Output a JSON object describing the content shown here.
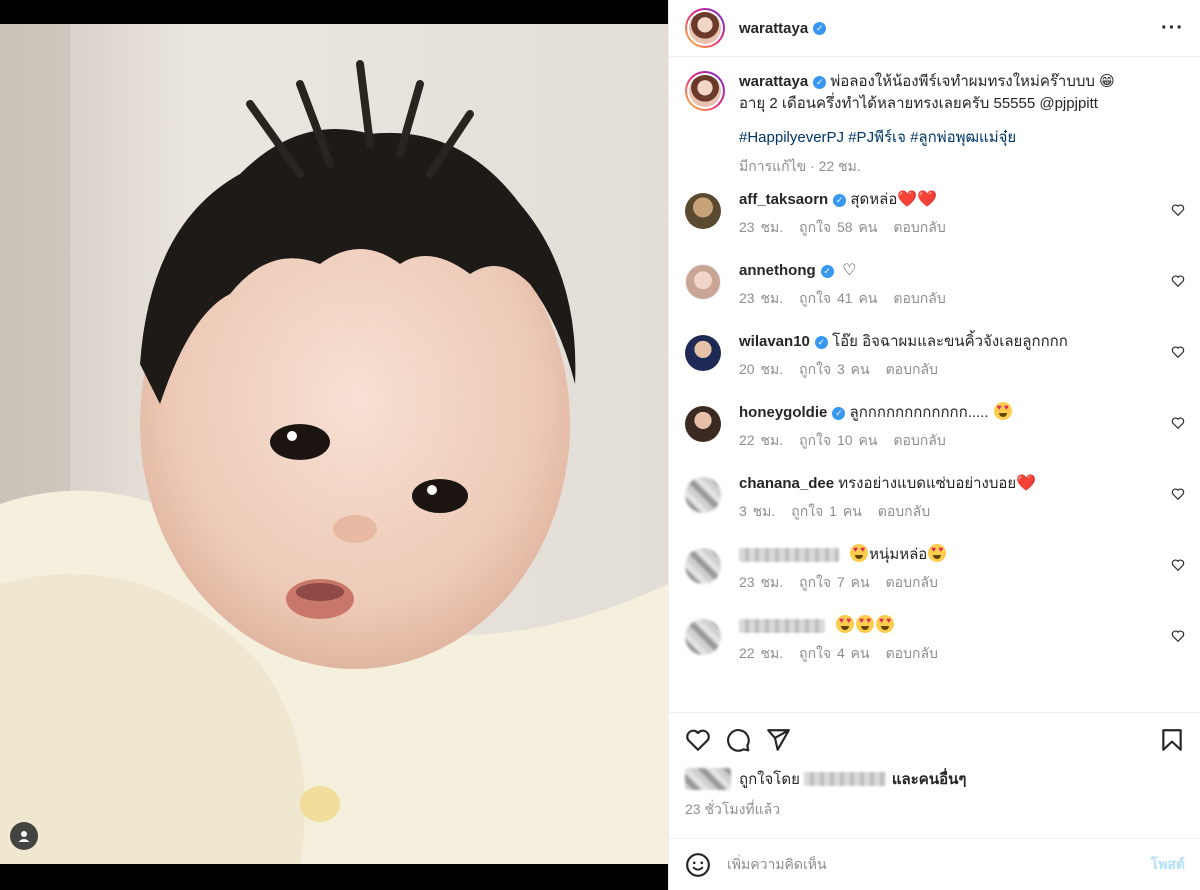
{
  "post": {
    "username": "warattaya",
    "caption_line1": "พ่อลองให้น้องพีร์เจทำผมทรงใหม่คร๊าบบบ 😁",
    "caption_line2": "อายุ 2 เดือนครึ่งทำได้หลายทรงเลยครับ 55555 @pjpjpitt",
    "hashtags": "#HappilyeverPJ #PJพีร์เจ #ลูกพ่อพุฒแม่จุ๋ย",
    "edited_meta": "มีการแก้ไข · 22 ชม."
  },
  "comments": [
    {
      "username": "aff_taksaorn",
      "verified": true,
      "text": "สุดหล่อ",
      "time": "23 ชม.",
      "likes": "ถูกใจ 58 คน",
      "reply": "ตอบกลับ",
      "avatar_color": "#7a6a4c"
    },
    {
      "username": "annethong",
      "verified": true,
      "text": "",
      "time": "23 ชม.",
      "likes": "ถูกใจ 41 คน",
      "reply": "ตอบกลับ",
      "avatar_color": "#d9c6bb"
    },
    {
      "username": "wilavan10",
      "verified": true,
      "text": "โอ๊ย อิจฉาผมและขนคิ้วจังเลยลูกกกก",
      "time": "20 ชม.",
      "likes": "ถูกใจ 3 คน",
      "reply": "ตอบกลับ",
      "avatar_color": "#2b3a6b"
    },
    {
      "username": "honeygoldie",
      "verified": true,
      "text": "ลูกกกกกกกกกกกก.....",
      "time": "22 ชม.",
      "likes": "ถูกใจ 10 คน",
      "reply": "ตอบกลับ",
      "avatar_color": "#4a3a32"
    },
    {
      "username": "chanana_dee",
      "verified": false,
      "text": "ทรงอย่างแบดแซ่บอย่างบอย",
      "time": "3 ชม.",
      "likes": "ถูกใจ 1 คน",
      "reply": "ตอบกลับ",
      "avatar_color": "#c9a28e"
    },
    {
      "username": "",
      "verified": false,
      "text": "หนุ่มหล่อ",
      "time": "23 ชม.",
      "likes": "ถูกใจ 7 คน",
      "reply": "ตอบกลับ",
      "avatar_color": "#999"
    },
    {
      "username": "",
      "verified": false,
      "text": "",
      "time": "22 ชม.",
      "likes": "ถูกใจ 4 คน",
      "reply": "ตอบกลับ",
      "avatar_color": "#999"
    }
  ],
  "footer": {
    "liked_by_prefix": "ถูกใจโดย",
    "liked_by_suffix": "และคนอื่นๆ",
    "time_ago": "23 ชั่วโมงที่แล้ว",
    "add_comment_placeholder": "เพิ่มความคิดเห็น",
    "post_label": "โพสต์"
  },
  "icons": [
    "heart-icon",
    "comment-icon",
    "share-icon",
    "bookmark-icon",
    "emoji-icon",
    "more-icon",
    "user-tag-icon",
    "verified-icon"
  ],
  "colors": {
    "accent_link": "#00376b",
    "verified": "#3897f0",
    "muted": "#8e8e8e",
    "post_disabled": "#b2dffc"
  }
}
